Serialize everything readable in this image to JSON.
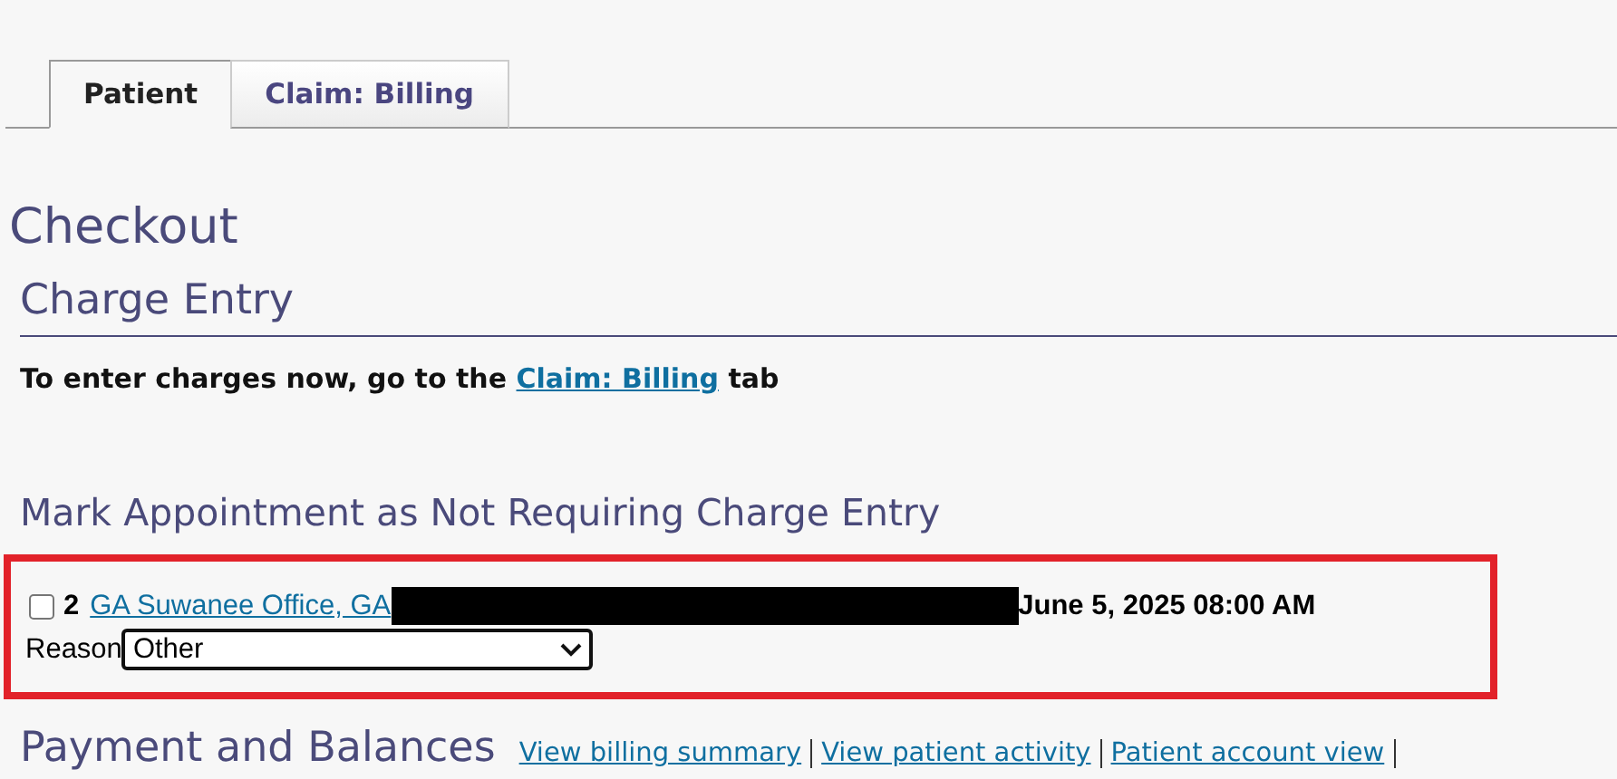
{
  "tabs": [
    {
      "label": "Patient",
      "selected": true
    },
    {
      "label": "Claim: Billing",
      "selected": false
    }
  ],
  "page_title": "Checkout",
  "charge_entry": {
    "heading": "Charge Entry",
    "instruction_before": "To enter charges now, go to the",
    "instruction_link": "Claim: Billing",
    "instruction_after": "tab"
  },
  "mark_appointment": {
    "heading": "Mark Appointment as Not Requiring Charge Entry",
    "appointments": [
      {
        "checked": false,
        "number": "2",
        "location": "GA Suwanee Office, GA",
        "redacted": true,
        "datetime": "June 5, 2025 08:00 AM",
        "reason_label": "Reason",
        "reason": "Other"
      }
    ]
  },
  "payment": {
    "heading": "Payment and Balances",
    "links": [
      "View billing summary",
      "View patient activity",
      "Patient account view"
    ]
  }
}
